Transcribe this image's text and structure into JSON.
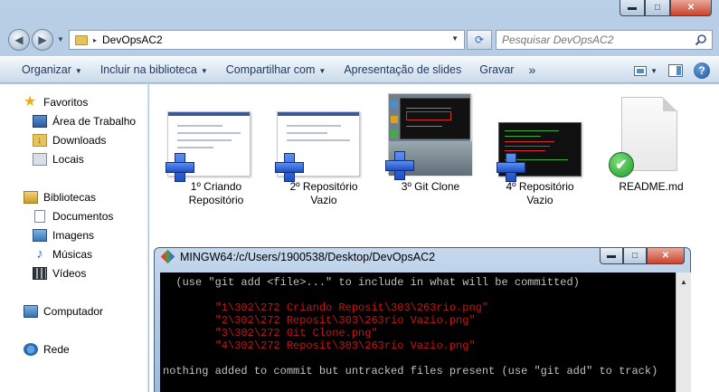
{
  "explorer": {
    "caption_buttons": {
      "minimize": "▬",
      "maximize": "□",
      "close": "✕"
    },
    "address": {
      "path": "DevOpsAC2",
      "arrow": "▸"
    },
    "search": {
      "placeholder": "Pesquisar DevOpsAC2"
    },
    "commands": {
      "organizar": "Organizar",
      "incluir": "Incluir na biblioteca",
      "compartilhar": "Compartilhar com",
      "apresentacao": "Apresentação de slides",
      "gravar": "Gravar",
      "more": "»",
      "help": "?"
    },
    "navpane": {
      "favoritos": "Favoritos",
      "area_de_trabalho": "Área de Trabalho",
      "downloads": "Downloads",
      "locais": "Locais",
      "bibliotecas": "Bibliotecas",
      "documentos": "Documentos",
      "imagens": "Imagens",
      "musicas": "Músicas",
      "videos": "Vídeos",
      "computador": "Computador",
      "rede": "Rede"
    },
    "files": [
      {
        "line1": "1º Criando",
        "line2": "Repositório",
        "icon": "image-thumbnail"
      },
      {
        "line1": "2º Repositório",
        "line2": "Vazio",
        "icon": "image-thumbnail"
      },
      {
        "line1": "3º Git Clone",
        "line2": "",
        "icon": "image-thumbnail"
      },
      {
        "line1": "4º Repositório",
        "line2": "Vazio",
        "icon": "image-thumbnail"
      },
      {
        "line1": "README.md",
        "line2": "",
        "icon": "document-check-icon"
      }
    ]
  },
  "terminal": {
    "title": "MINGW64:/c/Users/1900538/Desktop/DevOpsAC2",
    "caption_buttons": {
      "minimize": "▬",
      "maximize": "□",
      "close": "✕"
    },
    "lines": {
      "hint": "  (use \"git add <file>...\" to include in what will be committed)",
      "f1": "        \"1\\302\\272 Criando Reposit\\303\\263rio.png\"",
      "f2": "        \"2\\302\\272 Reposit\\303\\263rio Vazio.png\"",
      "f3": "        \"3\\302\\272 Git Clone.png\"",
      "f4": "        \"4\\302\\272 Reposit\\303\\263rio Vazio.png\"",
      "summary": "nothing added to commit but untracked files present (use \"git add\" to track)"
    }
  },
  "colors": {
    "terminal_bg": "#000000",
    "untracked_red": "#c81414",
    "command_text": "#1e395b"
  }
}
